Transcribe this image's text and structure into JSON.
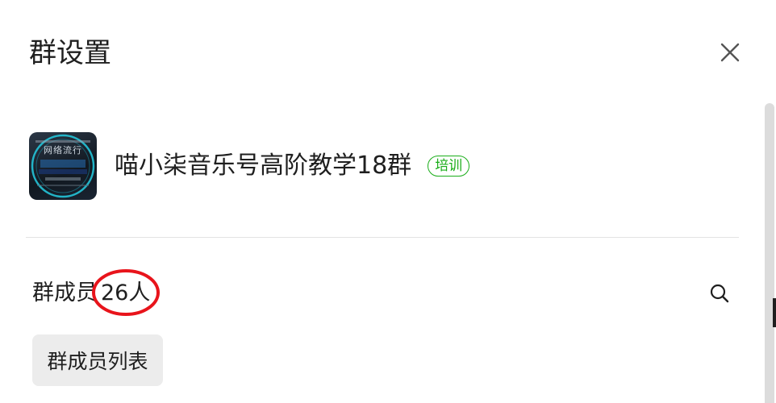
{
  "panel": {
    "title": "群设置"
  },
  "group": {
    "name": "喵小柒音乐号高阶教学18群",
    "badge": "培训",
    "avatar_text": "网络流行"
  },
  "members": {
    "label": "群成员",
    "count": "26人",
    "list_button_label": "群成员列表"
  },
  "colors": {
    "badge_green": "#1aad19",
    "annotation_red": "#e8141b",
    "button_bg": "#ececec"
  },
  "icons": {
    "close": "close-icon",
    "search": "search-icon"
  }
}
